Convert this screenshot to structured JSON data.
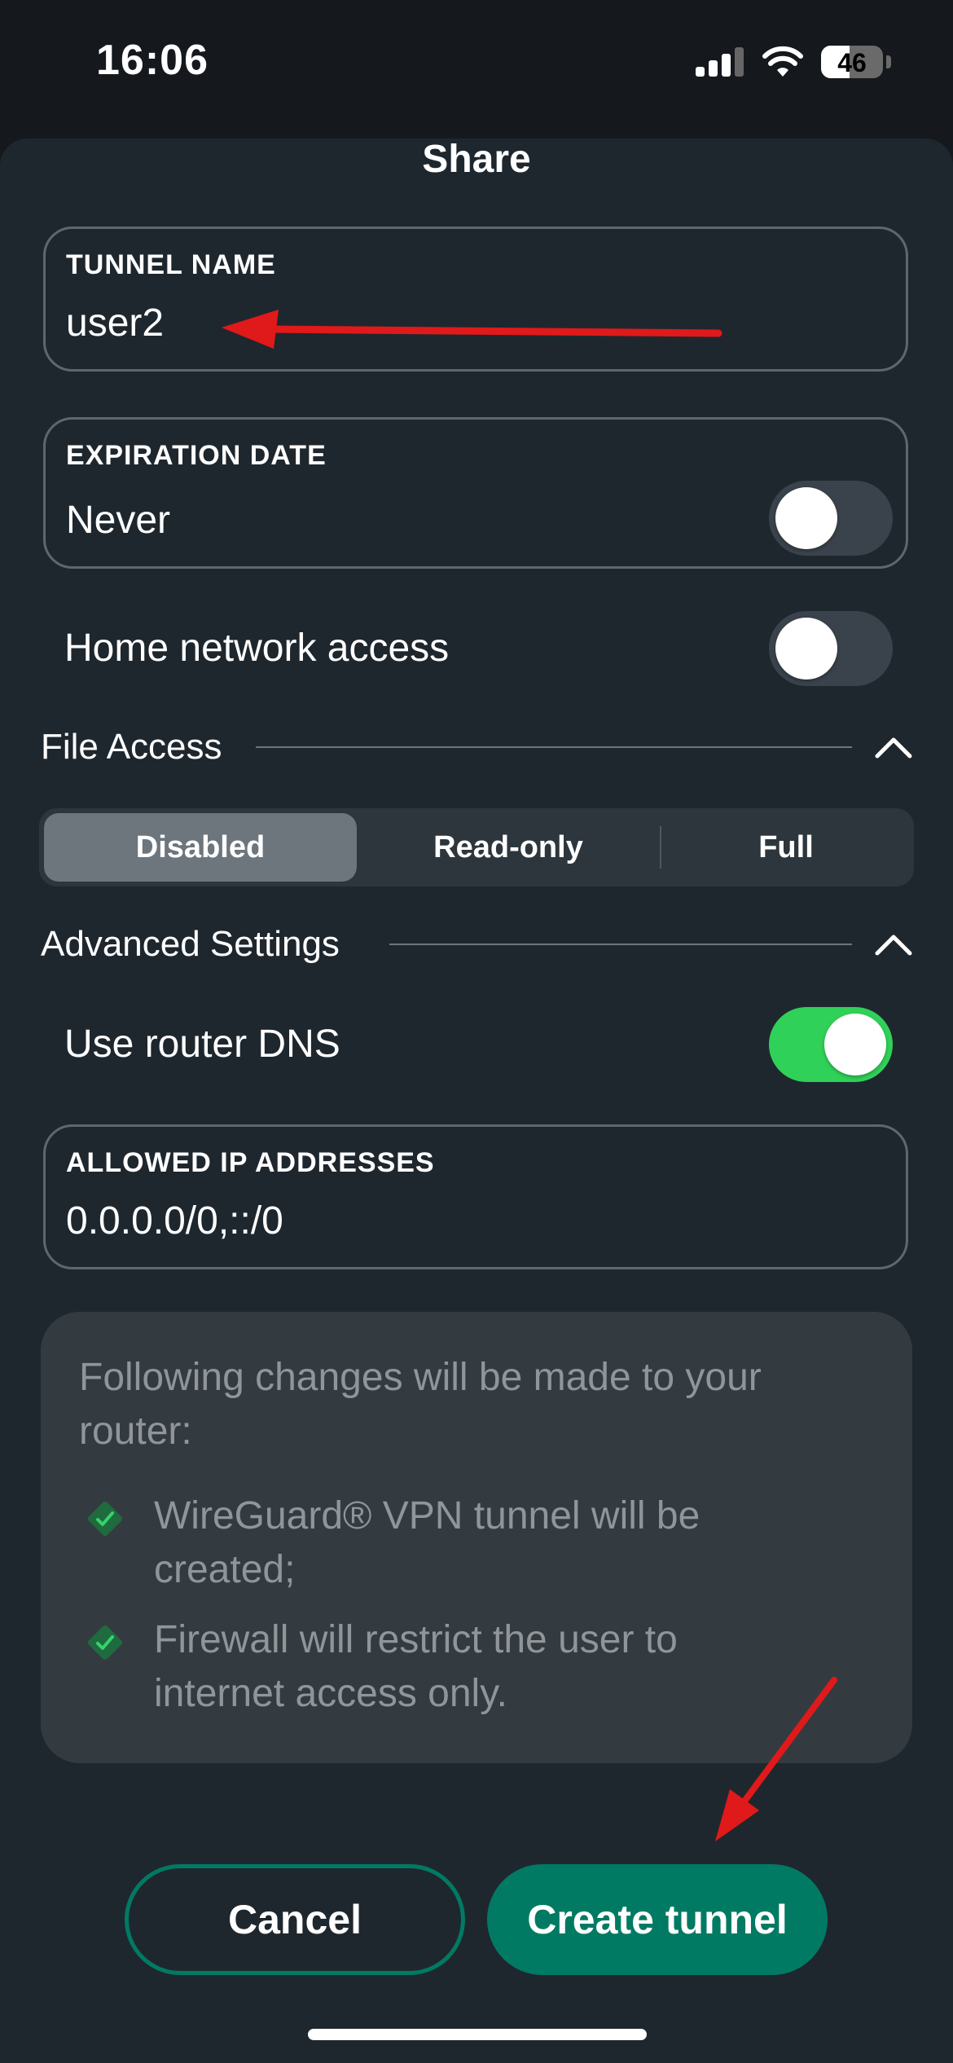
{
  "status_bar": {
    "time": "16:06",
    "battery_level": "46",
    "battery_fraction": 0.46
  },
  "sheet": {
    "title": "Share"
  },
  "tunnel_name": {
    "label": "TUNNEL NAME",
    "value": "user2"
  },
  "expiration": {
    "label": "EXPIRATION DATE",
    "value": "Never",
    "toggle_on": false
  },
  "home_network": {
    "label": "Home network access",
    "toggle_on": false
  },
  "file_access": {
    "title": "File Access",
    "options": [
      "Disabled",
      "Read-only",
      "Full"
    ],
    "selected": "Disabled"
  },
  "advanced": {
    "title": "Advanced Settings",
    "router_dns": {
      "label": "Use router DNS",
      "toggle_on": true
    },
    "allowed_ips": {
      "label": "ALLOWED IP ADDRESSES",
      "value": "0.0.0.0/0,::/0"
    }
  },
  "info": {
    "heading": "Following changes will be made to your router:",
    "items": [
      "WireGuard® VPN tunnel will be created;",
      "Firewall will restrict the user to internet access only."
    ]
  },
  "buttons": {
    "cancel": "Cancel",
    "create": "Create tunnel"
  },
  "colors": {
    "accent": "#017a63",
    "toggle_on": "#30d158",
    "annotation_arrow": "#e0191a"
  }
}
